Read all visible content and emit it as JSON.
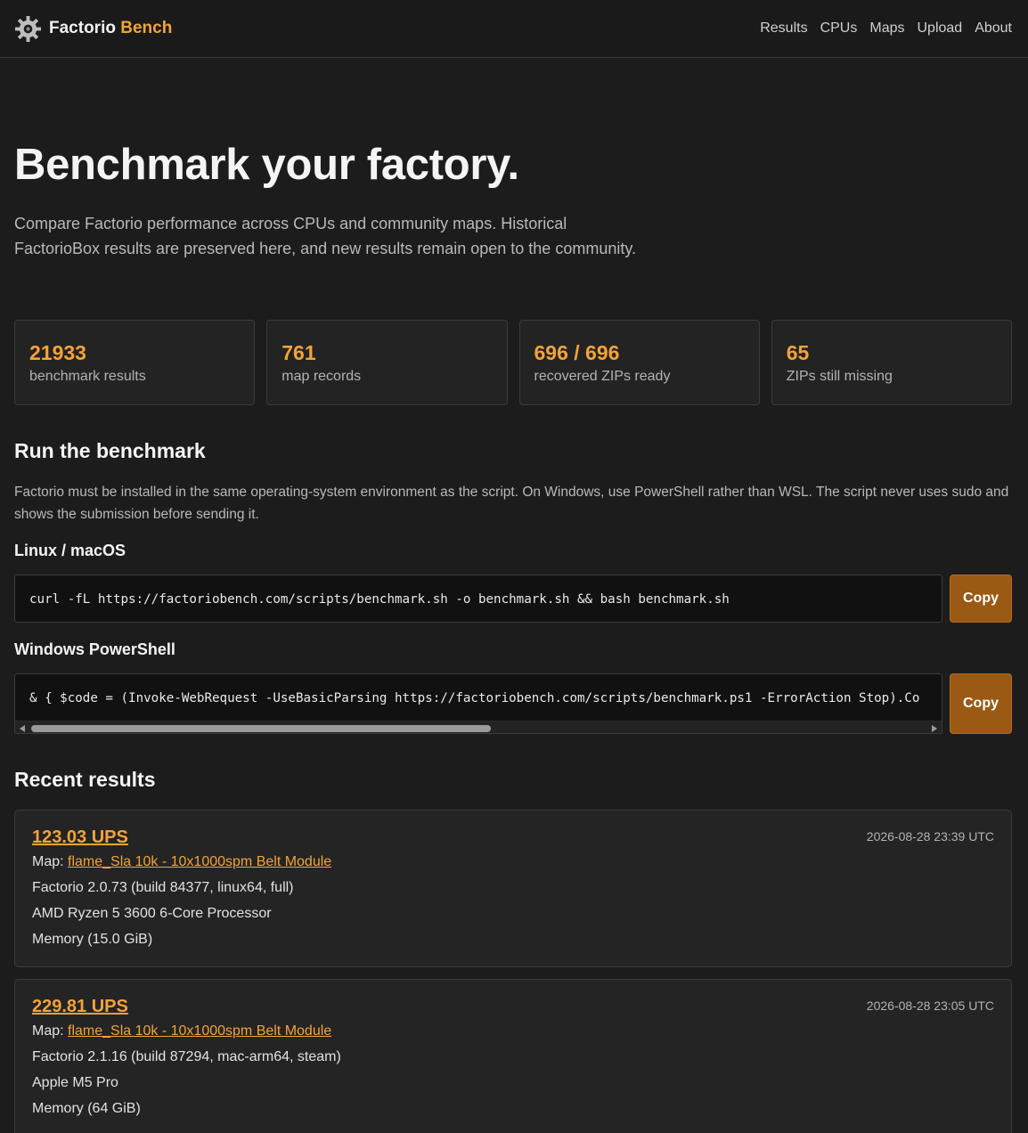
{
  "brand": {
    "name": "Factorio",
    "accent": "Bench"
  },
  "nav": [
    {
      "label": "Results"
    },
    {
      "label": "CPUs"
    },
    {
      "label": "Maps"
    },
    {
      "label": "Upload"
    },
    {
      "label": "About"
    }
  ],
  "hero": {
    "title": "Benchmark your factory.",
    "subtitle": "Compare Factorio performance across CPUs and community maps. Historical FactorioBox results are preserved here, and new results remain open to the community."
  },
  "stats": [
    {
      "value": "21933",
      "label": "benchmark results"
    },
    {
      "value": "761",
      "label": "map records"
    },
    {
      "value": "696 / 696",
      "label": "recovered ZIPs ready"
    },
    {
      "value": "65",
      "label": "ZIPs still missing"
    }
  ],
  "run": {
    "title": "Run the benchmark",
    "description": "Factorio must be installed in the same operating-system environment as the script. On Windows, use PowerShell rather than WSL. The script never uses sudo and shows the submission before sending it.",
    "linux": {
      "heading": "Linux / macOS",
      "command": "curl -fL https://factoriobench.com/scripts/benchmark.sh -o benchmark.sh && bash benchmark.sh",
      "copy_label": "Copy"
    },
    "windows": {
      "heading": "Windows PowerShell",
      "command": "& { $code = (Invoke-WebRequest -UseBasicParsing https://factoriobench.com/scripts/benchmark.ps1 -ErrorAction Stop).Co",
      "copy_label": "Copy"
    }
  },
  "recent": {
    "title": "Recent results",
    "items": [
      {
        "ups": "123.03 UPS",
        "date": "2026-08-28 23:39 UTC",
        "map_prefix": "Map: ",
        "map": "flame_Sla 10k - 10x1000spm Belt Module",
        "factorio": "Factorio 2.0.73 (build 84377, linux64, full)",
        "cpu": "AMD Ryzen 5 3600 6-Core Processor",
        "memory": "Memory (15.0 GiB)"
      },
      {
        "ups": "229.81 UPS",
        "date": "2026-08-28 23:05 UTC",
        "map_prefix": "Map: ",
        "map": "flame_Sla 10k - 10x1000spm Belt Module",
        "factorio": "Factorio 2.1.16 (build 87294, mac-arm64, steam)",
        "cpu": "Apple M5 Pro",
        "memory": "Memory (64 GiB)"
      }
    ]
  },
  "colors": {
    "accent": "#f2a33a",
    "button": "#9a5a13",
    "background": "#1c1c1c"
  }
}
